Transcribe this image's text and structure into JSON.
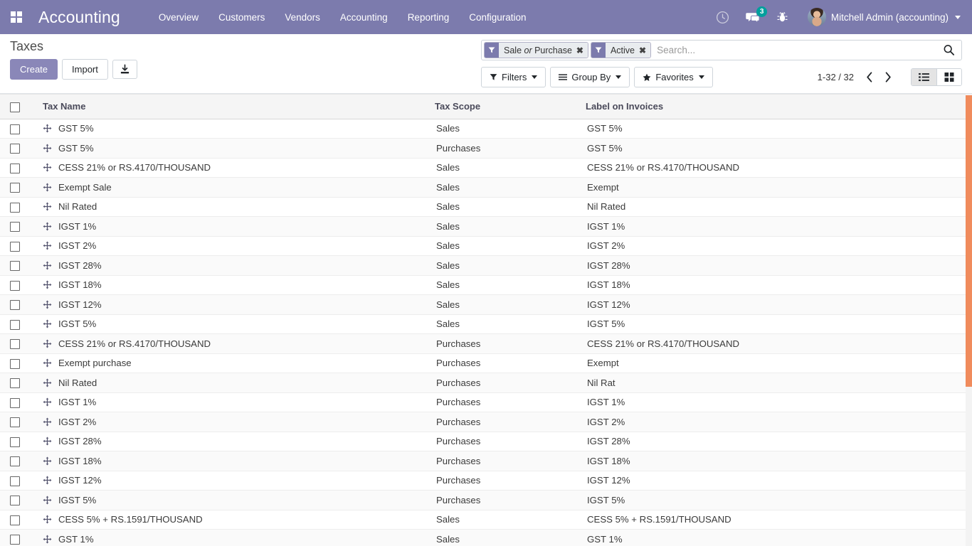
{
  "navbar": {
    "apps_icon": "apps-grid-icon",
    "brand": "Accounting",
    "menu": [
      {
        "label": "Overview"
      },
      {
        "label": "Customers"
      },
      {
        "label": "Vendors"
      },
      {
        "label": "Accounting"
      },
      {
        "label": "Reporting"
      },
      {
        "label": "Configuration"
      }
    ],
    "activities_icon": "clock-icon",
    "messages_icon": "chat-bubble-icon",
    "messages_count": "3",
    "debug_icon": "bug-icon",
    "avatar_icon": "user-avatar",
    "user_name": "Mitchell Admin (accounting)",
    "user_caret_icon": "chevron-down-icon"
  },
  "control_panel": {
    "title": "Taxes",
    "create_label": "Create",
    "import_label": "Import",
    "export_icon": "download-export-icon",
    "search": {
      "placeholder": "Search...",
      "value": "",
      "search_icon": "search-icon",
      "facets": [
        {
          "icon": "filter-funnel-icon",
          "text_before": "Sale ",
          "text_em": "or",
          "text_after": " Purchase",
          "remove_icon": "close-x-icon"
        },
        {
          "icon": "filter-funnel-icon",
          "text_before": "Active",
          "text_em": "",
          "text_after": "",
          "remove_icon": "close-x-icon"
        }
      ]
    },
    "filters_label": "Filters",
    "filters_icon": "filter-funnel-icon",
    "groupby_label": "Group By",
    "groupby_icon": "hamburger-lines-icon",
    "favorites_label": "Favorites",
    "favorites_icon": "star-icon",
    "pager": "1-32 / 32",
    "prev_icon": "chevron-left-icon",
    "next_icon": "chevron-right-icon",
    "view_list_icon": "list-view-icon",
    "view_kanban_icon": "kanban-view-icon"
  },
  "table": {
    "select_all_icon": "checkbox-unchecked",
    "columns": [
      "Tax Name",
      "Tax Scope",
      "Label on Invoices"
    ],
    "rows": [
      {
        "name": "GST 5%",
        "scope": "Sales",
        "label": "GST 5%"
      },
      {
        "name": "GST 5%",
        "scope": "Purchases",
        "label": "GST 5%"
      },
      {
        "name": "CESS 21% or RS.4170/THOUSAND",
        "scope": "Sales",
        "label": "CESS 21% or RS.4170/THOUSAND"
      },
      {
        "name": "Exempt Sale",
        "scope": "Sales",
        "label": "Exempt"
      },
      {
        "name": "Nil Rated",
        "scope": "Sales",
        "label": "Nil Rated"
      },
      {
        "name": "IGST 1%",
        "scope": "Sales",
        "label": "IGST 1%"
      },
      {
        "name": "IGST 2%",
        "scope": "Sales",
        "label": "IGST 2%"
      },
      {
        "name": "IGST 28%",
        "scope": "Sales",
        "label": "IGST 28%"
      },
      {
        "name": "IGST 18%",
        "scope": "Sales",
        "label": "IGST 18%"
      },
      {
        "name": "IGST 12%",
        "scope": "Sales",
        "label": "IGST 12%"
      },
      {
        "name": "IGST 5%",
        "scope": "Sales",
        "label": "IGST 5%"
      },
      {
        "name": "CESS 21% or RS.4170/THOUSAND",
        "scope": "Purchases",
        "label": "CESS 21% or RS.4170/THOUSAND"
      },
      {
        "name": "Exempt purchase",
        "scope": "Purchases",
        "label": "Exempt"
      },
      {
        "name": "Nil Rated",
        "scope": "Purchases",
        "label": "Nil Rat"
      },
      {
        "name": "IGST 1%",
        "scope": "Purchases",
        "label": "IGST 1%"
      },
      {
        "name": "IGST 2%",
        "scope": "Purchases",
        "label": "IGST 2%"
      },
      {
        "name": "IGST 28%",
        "scope": "Purchases",
        "label": "IGST 28%"
      },
      {
        "name": "IGST 18%",
        "scope": "Purchases",
        "label": "IGST 18%"
      },
      {
        "name": "IGST 12%",
        "scope": "Purchases",
        "label": "IGST 12%"
      },
      {
        "name": "IGST 5%",
        "scope": "Purchases",
        "label": "IGST 5%"
      },
      {
        "name": "CESS 5% + RS.1591/THOUSAND",
        "scope": "Sales",
        "label": "CESS 5% + RS.1591/THOUSAND"
      },
      {
        "name": "GST 1%",
        "scope": "Sales",
        "label": "GST 1%"
      }
    ],
    "row_checkbox_icon": "checkbox-unchecked",
    "row_handle_icon": "drag-move-icon"
  },
  "scrollbar": {
    "thumb_color": "#f08b5c"
  }
}
